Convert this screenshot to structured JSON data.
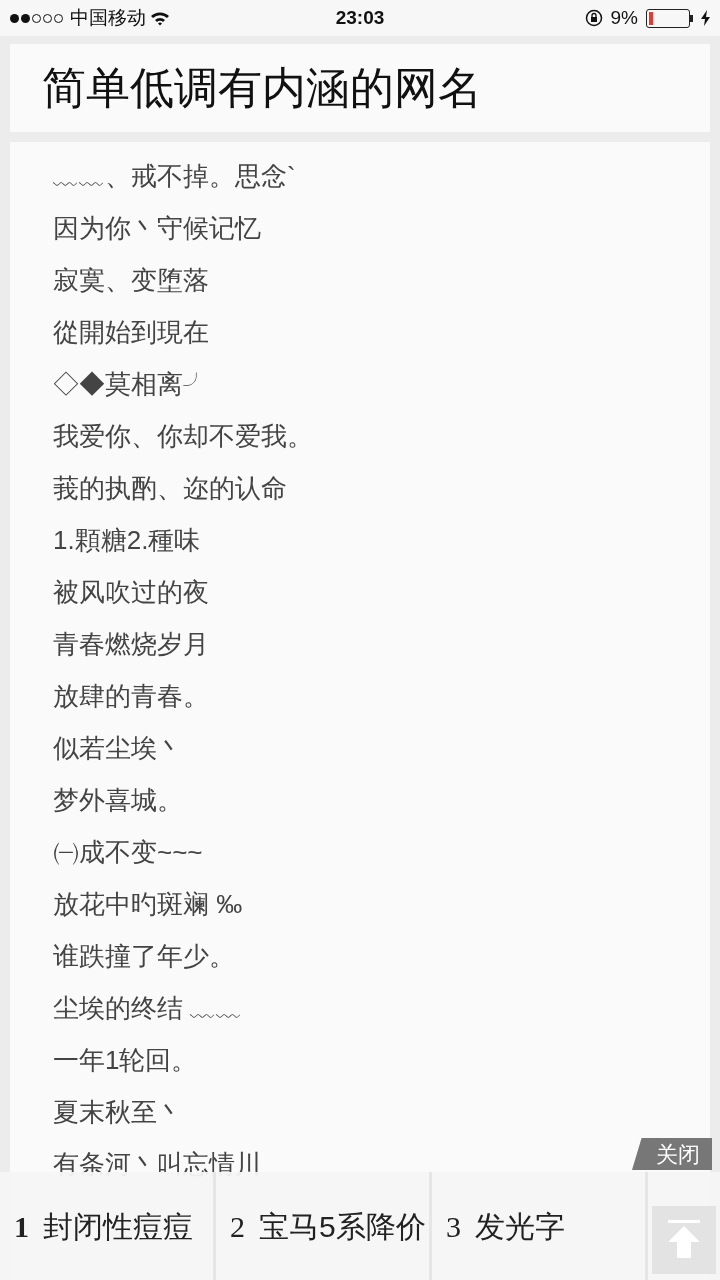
{
  "status_bar": {
    "carrier": "中国移动",
    "time": "23:03",
    "battery_percent": "9%",
    "charging": true
  },
  "header": {
    "title": "简单低调有内涵的网名"
  },
  "names": [
    "﹏﹏、戒不掉。思念`",
    "因为你丶守候记忆",
    "寂寞、变堕落",
    "從開始到現在",
    "◇◆莫相离╯",
    "我爱你、你却不爱我。",
    "莪的执酌、迩的认命",
    "1.顆糖2.種味",
    "被风吹过的夜",
    "青春燃烧岁月",
    "放肆的青春。",
    "似若尘埃丶",
    "梦外喜城。",
    "㈠成不变~~~",
    "放花中旳斑斓 ‰",
    "谁跌撞了年少。",
    "尘埃的终结 ﹏﹏",
    "一年1轮回。",
    "夏末秋至丶",
    "有条河丶叫忘情川"
  ],
  "hot_bar": {
    "close_label": "关闭",
    "items": [
      {
        "rank": "1",
        "label": "封闭性痘痘"
      },
      {
        "rank": "2",
        "label": "宝马5系降价"
      },
      {
        "rank": "3",
        "label": "发光字"
      }
    ]
  }
}
